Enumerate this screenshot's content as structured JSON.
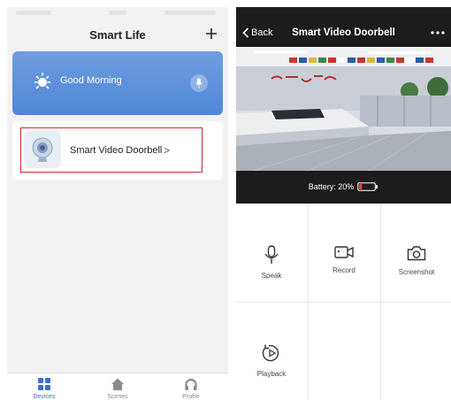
{
  "left": {
    "title": "Smart Life",
    "add_icon": "plus-icon",
    "greeting": "Good Morning",
    "greeting_icons": [
      "sun-icon",
      "microphone-icon"
    ],
    "device": {
      "name": "Smart  Video Doorbell",
      "chevron": ">",
      "icon": "camera-icon"
    },
    "tabs": [
      {
        "label": "Devices",
        "icon": "grid-icon",
        "active": true
      },
      {
        "label": "Scenes",
        "icon": "home-icon",
        "active": false
      },
      {
        "label": "Profile",
        "icon": "headphones-icon",
        "active": false
      }
    ],
    "colors": {
      "accent": "#3d6fd6",
      "card_top": "#6f9ee0",
      "card_bottom": "#4f86d6",
      "highlight": "#d12a2a"
    }
  },
  "right": {
    "back_label": "Back",
    "title": "Smart  Video Doorbell",
    "more_icon": "ellipsis-icon",
    "battery": {
      "label": "Battery: 20%",
      "level": 0.2,
      "color": "#e8412c"
    },
    "controls": [
      {
        "label": "Speak",
        "icon": "microphone-icon"
      },
      {
        "label": "Record",
        "icon": "video-camera-icon"
      },
      {
        "label": "Screenshot",
        "icon": "camera-icon"
      },
      {
        "label": "Playback",
        "icon": "playback-icon"
      }
    ]
  }
}
